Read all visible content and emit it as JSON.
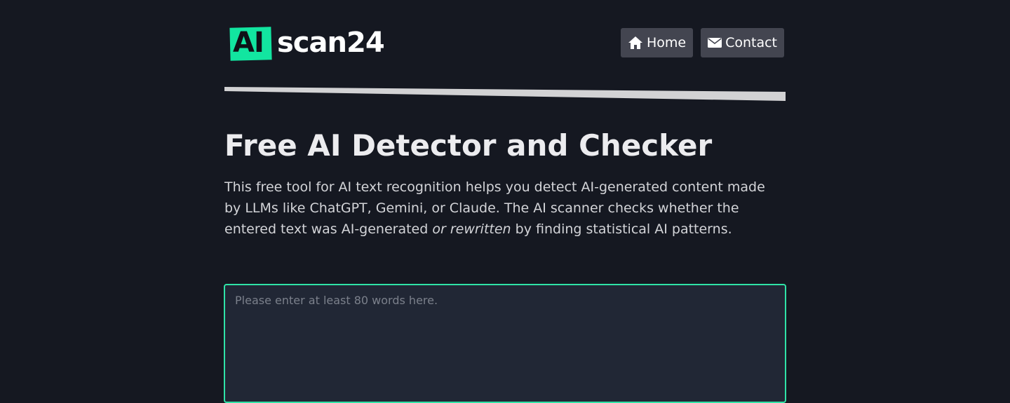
{
  "brand": {
    "logo_ai": "AI",
    "logo_rest": "scan24",
    "accent_color": "#12e5a0"
  },
  "nav": {
    "home_label": "Home",
    "home_icon": "home-icon",
    "contact_label": "Contact",
    "contact_icon": "envelope-icon"
  },
  "main": {
    "title": "Free AI Detector and Checker",
    "intro_part1": "This free tool for AI text recognition helps you detect AI-generated content made by LLMs like ChatGPT, Gemini, or Claude. The AI scanner checks whether the entered text was AI-generated ",
    "intro_emphasis": "or rewritten",
    "intro_part2": " by finding statistical AI patterns.",
    "input_placeholder": "Please enter at least 80 words here.",
    "input_value": ""
  },
  "colors": {
    "background": "#151821",
    "input_background": "#212735",
    "input_border": "#2fe3a7",
    "nav_button": "#434550"
  }
}
